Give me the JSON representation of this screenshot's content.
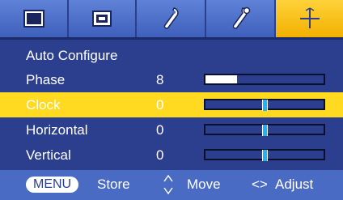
{
  "tabs": [
    {
      "icon": "picture-icon",
      "active": false
    },
    {
      "icon": "screen-icon",
      "active": false
    },
    {
      "icon": "wrench-icon",
      "active": false
    },
    {
      "icon": "wrench-option-icon",
      "active": false
    },
    {
      "icon": "crosshair-icon",
      "active": true
    }
  ],
  "menu": {
    "rows": [
      {
        "label": "Auto Configure",
        "value": "",
        "level": null,
        "selected": false
      },
      {
        "label": "Phase",
        "value": "8",
        "level": 0.27,
        "selected": false
      },
      {
        "label": "Clock",
        "value": "0",
        "level": 0.5,
        "selected": true
      },
      {
        "label": "Horizontal",
        "value": "0",
        "level": 0.5,
        "selected": false
      },
      {
        "label": "Vertical",
        "value": "0",
        "level": 0.5,
        "selected": false
      }
    ]
  },
  "footer": {
    "menu_key": "MENU",
    "store": "Store",
    "updown_glyph": "updown-arrows-icon",
    "move": "Move",
    "leftright_glyph": "<>",
    "adjust": "Adjust"
  },
  "colors": {
    "background": "#2b3f8e",
    "tab": "#4a6bc4",
    "active_tab": "#f2b000",
    "selection": "#ffda21",
    "slider_fill": "#ffffff",
    "slider_thumb": "#22b4f0"
  }
}
